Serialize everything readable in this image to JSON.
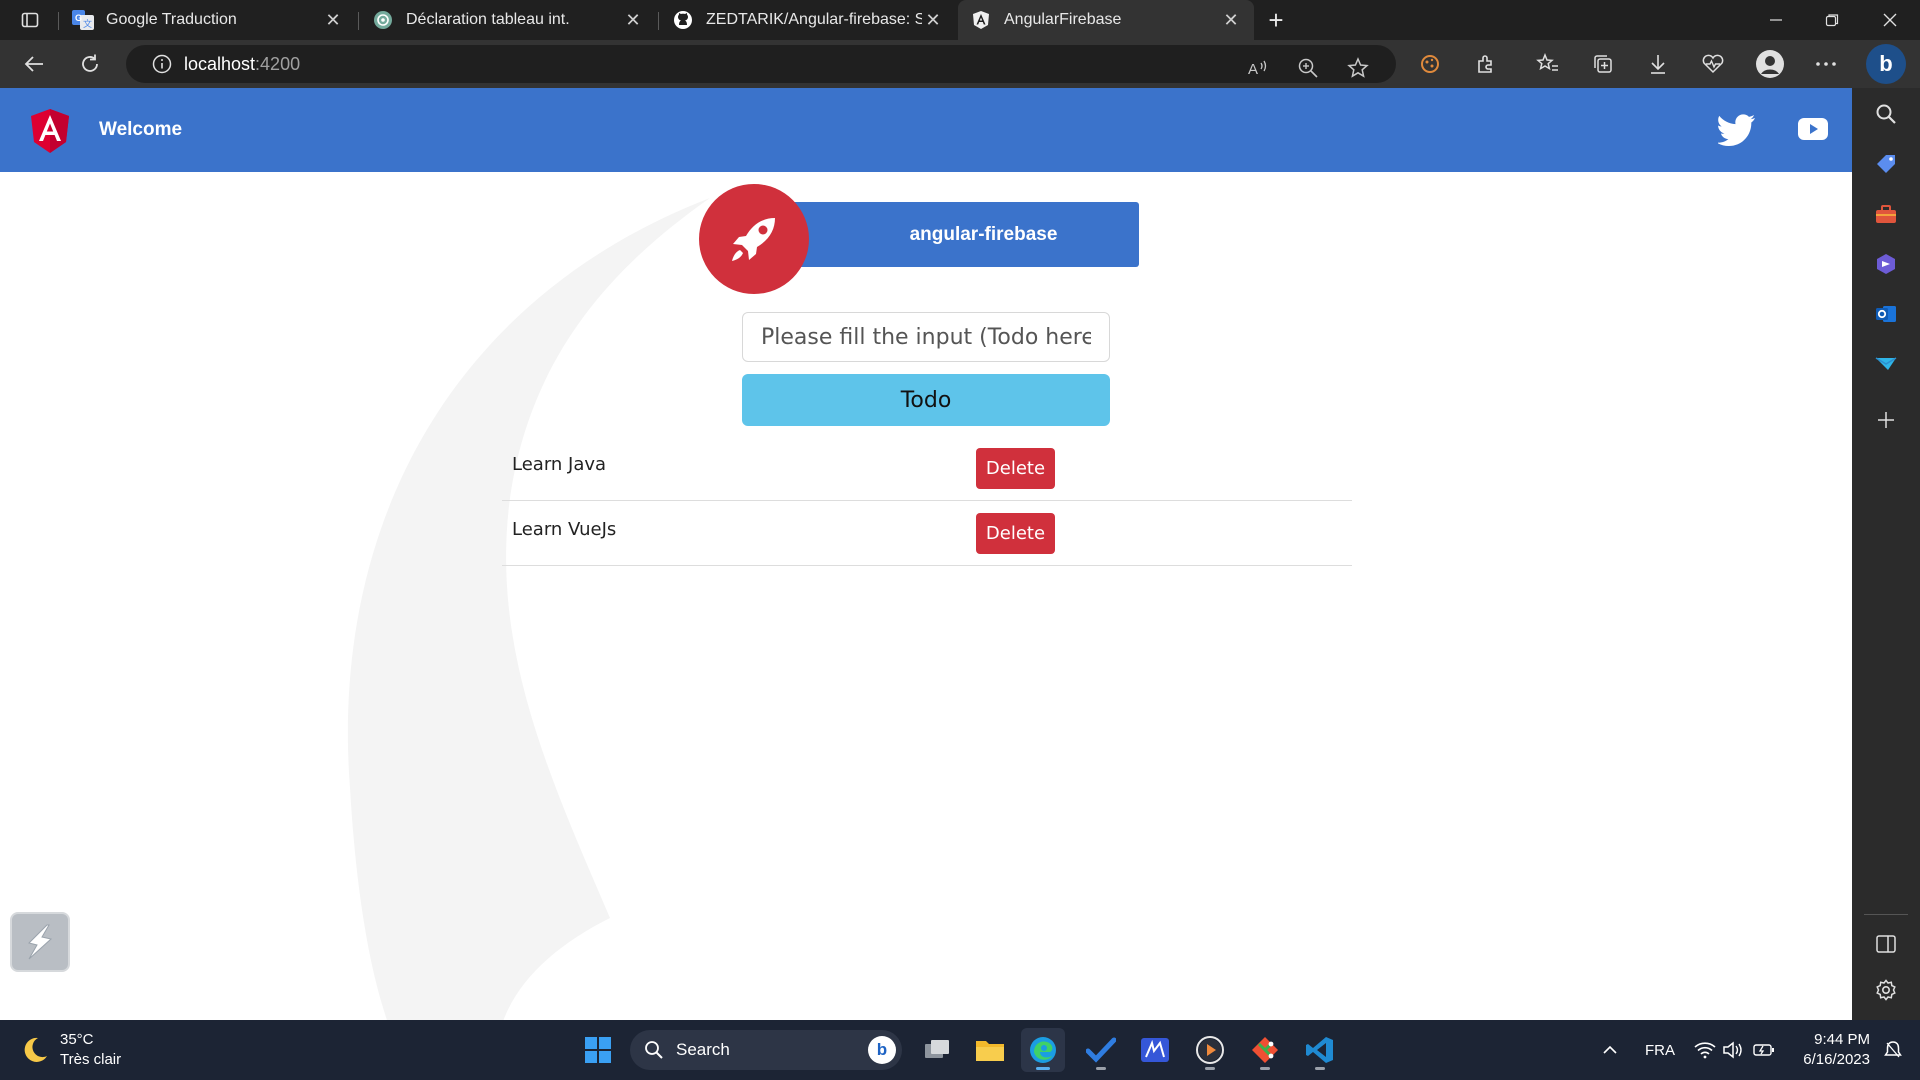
{
  "browser": {
    "tabs": [
      {
        "label": "Google Traduction",
        "favicon": "google-translate-icon"
      },
      {
        "label": "Déclaration tableau int.",
        "favicon": "chatgpt-icon"
      },
      {
        "label": "ZEDTARIK/Angular-firebase: Sma",
        "favicon": "github-icon"
      },
      {
        "label": "AngularFirebase",
        "favicon": "angular-icon"
      }
    ],
    "active_tab": 3,
    "url_host": "localhost",
    "url_port": ":4200"
  },
  "app": {
    "header_title": "Welcome",
    "brand": "angular-firebase",
    "input_placeholder": "Please fill the input (Todo here) ...",
    "add_button": "Todo",
    "todos": [
      {
        "text": "Learn Java",
        "delete_label": "Delete"
      },
      {
        "text": "Learn VueJs",
        "delete_label": "Delete"
      }
    ],
    "colors": {
      "primary": "#3b73cb",
      "danger": "#d0303c",
      "info": "#5ec4ea"
    }
  },
  "taskbar": {
    "weather_temp": "35°C",
    "weather_desc": "Très clair",
    "search_label": "Search",
    "language": "FRA",
    "time": "9:44 PM",
    "date": "6/16/2023"
  }
}
